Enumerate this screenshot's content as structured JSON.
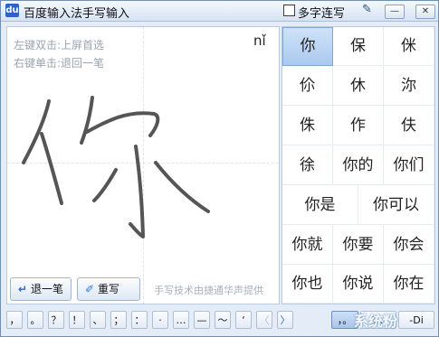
{
  "titlebar": {
    "title": "百度输入法手写输入",
    "app_icon": "du-logo-icon",
    "multi_char_label": "多字连写",
    "min_glyph": "—",
    "max_glyph": "▭",
    "close_glyph": "✕"
  },
  "write_area": {
    "hint_left_double": "左键双击:上屏首选",
    "hint_right_single": "右键单击:退回一笔",
    "pinyin": "nǐ",
    "back_label": "退一笔",
    "rewrite_label": "重写",
    "credit": "手写技术由捷通华声提供"
  },
  "candidates": {
    "cells": [
      "你",
      "保",
      "侎",
      "伱",
      "休",
      "沵",
      "侏",
      "作",
      "伕",
      "徐",
      "你的",
      "你们",
      "你是",
      "你可以",
      "你就",
      "你要",
      "你会",
      "你也",
      "你说",
      "你在"
    ],
    "selected": "你"
  },
  "punct_bar": {
    "keys": [
      "，",
      "。",
      "？",
      "！",
      "、",
      "；",
      "：",
      "·",
      "…",
      "—",
      "～",
      "‘"
    ],
    "prev_glyph": "〈",
    "next_glyph": "〉",
    "mode_labels": [
      "，。",
      "1...",
      "-Di"
    ],
    "watermark": "系统粉"
  },
  "colors": {
    "selected_cell": "#a9c9ee",
    "stroke": "#555555",
    "accent": "#2d66c9"
  }
}
